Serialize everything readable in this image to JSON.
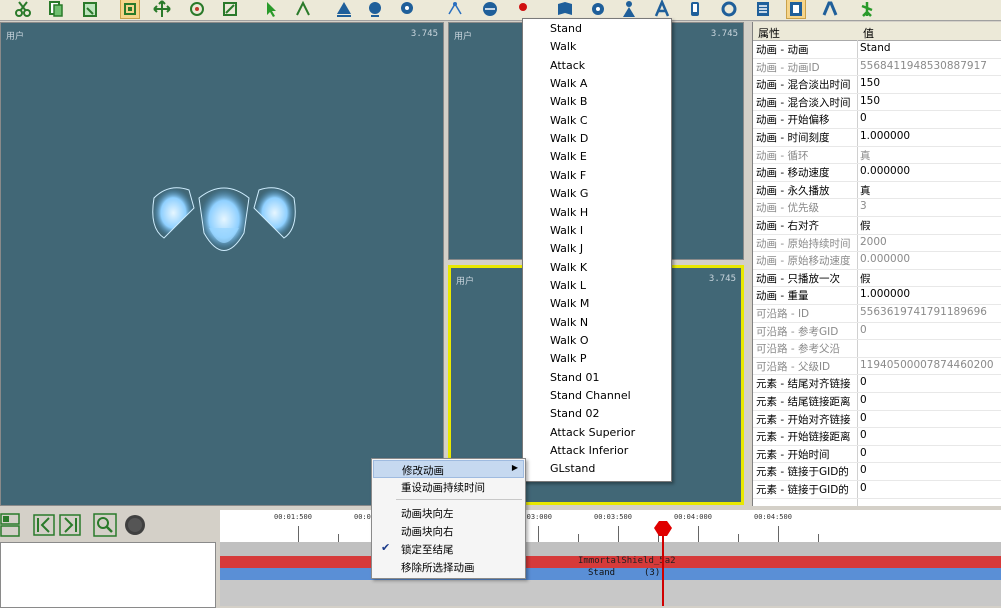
{
  "toolbar": {
    "icons": [
      "scissors-icon",
      "copy-icon",
      "paste-icon",
      "select-icon",
      "move-icon",
      "rotate-icon",
      "scale-icon",
      "pointer-icon",
      "pointer-alt-icon",
      "triangle-icon",
      "bone-icon",
      "bone-alt-icon",
      "link-icon",
      "sphere-icon",
      "record-icon",
      "book-icon",
      "gear-icon",
      "character-icon",
      "text-a-icon",
      "tube-icon",
      "settings-icon",
      "list-icon",
      "film-icon",
      "skeleton-icon",
      "figure-icon"
    ]
  },
  "viewports": {
    "main": {
      "label": "用户",
      "value": "3.745"
    },
    "top_right": {
      "label": "用户",
      "value": "3.745"
    },
    "bottom_right": {
      "label": "用户",
      "value": "3.745"
    }
  },
  "properties": {
    "header_key": "属性",
    "header_val": "值",
    "rows": [
      {
        "k": "动画 - 动画",
        "v": "Stand",
        "dim": false
      },
      {
        "k": "动画 - 动画ID",
        "v": "5568411948530887917",
        "dim": true
      },
      {
        "k": "动画 - 混合淡出时间",
        "v": "150",
        "dim": false
      },
      {
        "k": "动画 - 混合淡入时间",
        "v": "150",
        "dim": false
      },
      {
        "k": "动画 - 开始偏移",
        "v": "0",
        "dim": false
      },
      {
        "k": "动画 - 时间刻度",
        "v": "1.000000",
        "dim": false
      },
      {
        "k": "动画 - 循环",
        "v": "真",
        "dim": true
      },
      {
        "k": "动画 - 移动速度",
        "v": "0.000000",
        "dim": false
      },
      {
        "k": "动画 - 永久播放",
        "v": "真",
        "dim": false
      },
      {
        "k": "动画 - 优先级",
        "v": "3",
        "dim": true
      },
      {
        "k": "动画 - 右对齐",
        "v": "假",
        "dim": false
      },
      {
        "k": "动画 - 原始持续时间",
        "v": "2000",
        "dim": true
      },
      {
        "k": "动画 - 原始移动速度",
        "v": "0.000000",
        "dim": true
      },
      {
        "k": "动画 - 只播放一次",
        "v": "假",
        "dim": false
      },
      {
        "k": "动画 - 重量",
        "v": "1.000000",
        "dim": false
      },
      {
        "k": "可沿路 - ID",
        "v": "5563619741791189696",
        "dim": true
      },
      {
        "k": "可沿路 - 参考GID",
        "v": "0",
        "dim": true
      },
      {
        "k": "可沿路 - 参考父沿",
        "v": "",
        "dim": true
      },
      {
        "k": "可沿路 - 父级ID",
        "v": "11940500007874460200",
        "dim": true
      },
      {
        "k": "元素 - 结尾对齐链接",
        "v": "0",
        "dim": false
      },
      {
        "k": "元素 - 结尾链接距离",
        "v": "0",
        "dim": false
      },
      {
        "k": "元素 - 开始对齐链接",
        "v": "0",
        "dim": false
      },
      {
        "k": "元素 - 开始链接距离",
        "v": "0",
        "dim": false
      },
      {
        "k": "元素 - 开始时间",
        "v": "0",
        "dim": false
      },
      {
        "k": "元素 - 链接于GID的",
        "v": "0",
        "dim": false
      },
      {
        "k": "元素 - 链接于GID的",
        "v": "0",
        "dim": false
      }
    ]
  },
  "dropdown": {
    "items": [
      "Stand",
      "Walk",
      "Attack",
      "Walk A",
      "Walk B",
      "Walk C",
      "Walk D",
      "Walk E",
      "Walk F",
      "Walk G",
      "Walk H",
      "Walk I",
      "Walk J",
      "Walk K",
      "Walk L",
      "Walk M",
      "Walk N",
      "Walk O",
      "Walk P",
      "Stand 01",
      "Stand Channel",
      "Stand 02",
      "Attack Superior",
      "Attack Inferior",
      "GLstand"
    ]
  },
  "context_menu": {
    "items": [
      {
        "label": "修改动画",
        "submenu": true,
        "checked": false,
        "highlight": true
      },
      {
        "label": "重设动画持续时间",
        "submenu": false,
        "checked": false,
        "highlight": false
      },
      {
        "label": "动画块向左",
        "submenu": false,
        "checked": false,
        "highlight": false
      },
      {
        "label": "动画块向右",
        "submenu": false,
        "checked": false,
        "highlight": false
      },
      {
        "label": "锁定至结尾",
        "submenu": false,
        "checked": true,
        "highlight": false
      },
      {
        "label": "移除所选择动画",
        "submenu": false,
        "checked": false,
        "highlight": false
      }
    ]
  },
  "timeline": {
    "ticks": [
      "00:01:500",
      "00:02:000",
      "00:02:500",
      "00:03:000",
      "00:03:500",
      "00:04:000",
      "00:04:500"
    ],
    "red_track_label": "ImmortalShield_5a2",
    "blue_track_label": "Stand",
    "blue_track_count": "(3)"
  },
  "colors": {
    "viewport_bg": "#416776",
    "active_border": "#e8e800",
    "playhead": "#d00000"
  }
}
